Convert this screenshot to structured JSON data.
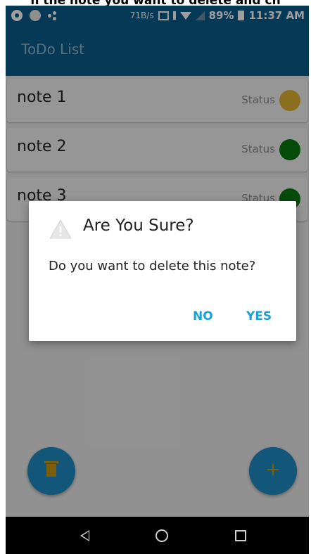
{
  "caption": "h the note you want to delete and ch",
  "status_bar": {
    "speed": "71B/s",
    "battery": "89%",
    "time": "11:37 AM"
  },
  "app_bar": {
    "title": "ToDo List"
  },
  "notes": [
    {
      "title": "note 1",
      "status_label": "Status",
      "status_color": "#e0b432"
    },
    {
      "title": "note 2",
      "status_label": "Status",
      "status_color": "#0c7a12"
    },
    {
      "title": "note 3",
      "status_label": "Status",
      "status_color": "#0c7a12"
    }
  ],
  "dialog": {
    "icon": "warning-icon",
    "title": "Are You Sure?",
    "message": "Do you want to delete this note?",
    "no_label": "NO",
    "yes_label": "YES"
  },
  "fabs": {
    "delete_icon": "trash-icon",
    "add_icon": "plus-icon"
  },
  "colors": {
    "primary": "#0a5d8a",
    "accent": "#1ba1d4",
    "fab_icon": "#c79a12"
  }
}
